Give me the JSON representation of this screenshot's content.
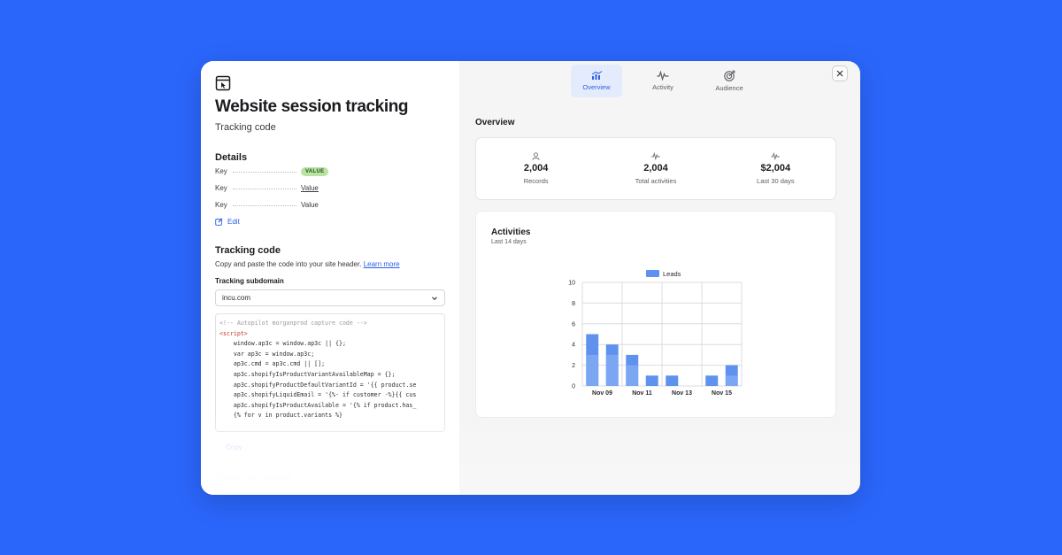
{
  "left": {
    "title": "Website session tracking",
    "subtitle": "Tracking code",
    "details": {
      "heading": "Details",
      "rows": [
        {
          "key": "Key",
          "value": "VALUE"
        },
        {
          "key": "Key",
          "value": "Value"
        },
        {
          "key": "Key",
          "value": "Value"
        }
      ],
      "edit_label": "Edit"
    },
    "tracking": {
      "heading": "Tracking code",
      "description": "Copy and paste the code into your site header.",
      "learn_more": "Learn more",
      "subdomain_label": "Tracking subdomain",
      "subdomain_value": "incu.com",
      "code_lines": [
        "<!-- Autopilot morganprod capture code -->",
        "<script>",
        "    window.ap3c = window.ap3c || {};",
        "    var ap3c = window.ap3c;",
        "    ap3c.cmd = ap3c.cmd || [];",
        "    ap3c.shopifyIsProductVariantAvailableMap = {};",
        "",
        "    ap3c.shopifyProductDefaultVariantId = '{{ product.se",
        "    ap3c.shopifyLiquidEmail = '{%- if customer -%}{{ cus",
        "    ap3c.shopifyIsProductAvailable = '{% if product.has_",
        "    {% for v in product.variants %}"
      ],
      "copy_label": "Copy"
    },
    "email_heading": "Email instructions"
  },
  "tabs": [
    {
      "label": "Overview",
      "icon": "chart-icon",
      "active": true
    },
    {
      "label": "Activity",
      "icon": "activity-icon",
      "active": false
    },
    {
      "label": "Audience",
      "icon": "target-icon",
      "active": false
    }
  ],
  "overview": {
    "heading": "Overview",
    "stats": [
      {
        "value": "2,004",
        "label": "Records",
        "icon": "person-icon"
      },
      {
        "value": "2,004",
        "label": "Total activities",
        "icon": "activity-icon"
      },
      {
        "value": "$2,004",
        "label": "Last 30 days",
        "icon": "activity-icon"
      }
    ]
  },
  "colors": {
    "background": "#2b66fb",
    "accent": "#2b5fe6",
    "bar": "#5e92ee",
    "bar_light": "#8fb4f5",
    "badge_bg": "#b9e2a3"
  },
  "chart_data": {
    "type": "bar",
    "title": "Activities",
    "subtitle": "Last 14 days",
    "legend": "top",
    "categories": [
      "Nov 09",
      "Nov 10",
      "Nov 11",
      "Nov 12",
      "Nov 13",
      "Nov 14",
      "Nov 15",
      "Nov 16"
    ],
    "tick_labels": [
      "Nov 09",
      "Nov 11",
      "Nov 13",
      "Nov 15"
    ],
    "series": [
      {
        "name": "Leads",
        "values": [
          5,
          4,
          3,
          1,
          1,
          0,
          1,
          2
        ]
      }
    ],
    "ylim": [
      0,
      10
    ],
    "yticks": [
      0,
      2,
      4,
      6,
      8,
      10
    ],
    "grid": true
  }
}
